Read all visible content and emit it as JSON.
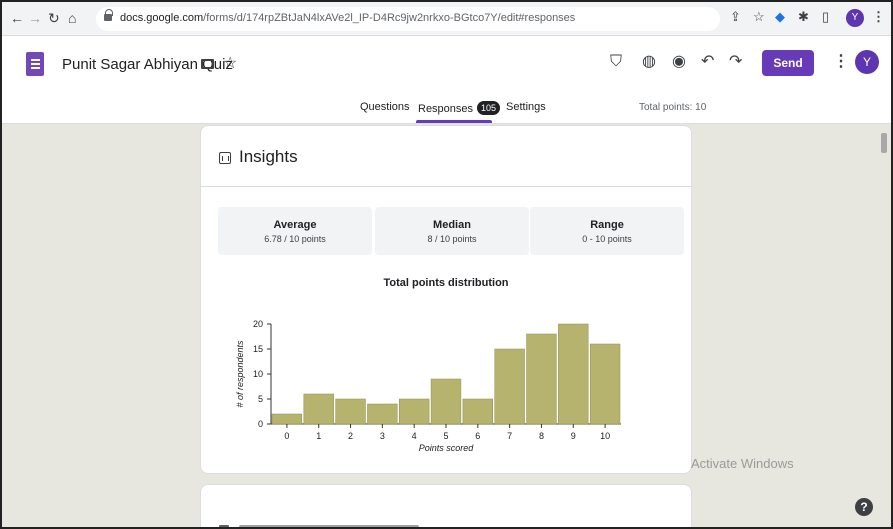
{
  "browser": {
    "url_host": "docs.google.com",
    "url_path": "/forms/d/174rpZBtJaN4lxAVe2l_IP-D4Rc9jw2nrkxo-BGtco7Y/edit#responses",
    "avatar_letter": "Y"
  },
  "header": {
    "doc_title": "Punit Sagar Abhiyan Quiz",
    "send_label": "Send",
    "avatar_letter": "Y"
  },
  "tabs": [
    {
      "label": "Questions",
      "active": false
    },
    {
      "label": "Responses",
      "active": true,
      "badge": "105"
    },
    {
      "label": "Settings",
      "active": false
    }
  ],
  "total_points": "Total points: 10",
  "insights": {
    "title": "Insights",
    "stats": [
      {
        "label": "Average",
        "value": "6.78 / 10 points"
      },
      {
        "label": "Median",
        "value": "8 / 10 points"
      },
      {
        "label": "Range",
        "value": "0 - 10 points"
      }
    ]
  },
  "chart_data": {
    "type": "bar",
    "title": "Total points distribution",
    "xlabel": "Points scored",
    "ylabel": "# of respondents",
    "categories": [
      "0",
      "1",
      "2",
      "3",
      "4",
      "5",
      "6",
      "7",
      "8",
      "9",
      "10"
    ],
    "values": [
      2,
      6,
      5,
      4,
      5,
      9,
      5,
      15,
      18,
      20,
      16
    ],
    "ylim": [
      0,
      20
    ],
    "yticks": [
      0,
      5,
      10,
      15,
      20
    ],
    "bar_color": "#b5b36e",
    "grid": false
  },
  "watermark": "Activate Windows",
  "help_label": "?"
}
